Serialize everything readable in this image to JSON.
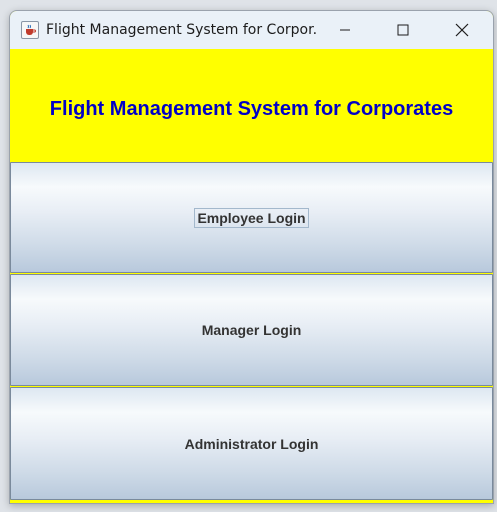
{
  "window": {
    "title": "Flight Management System for Corpor...",
    "app_icon": "java-cup-icon",
    "controls": {
      "minimize_icon": "minimize-icon",
      "maximize_icon": "maximize-icon",
      "close_icon": "close-icon"
    }
  },
  "header": {
    "title": "Flight Management System for Corporates",
    "background_color": "#ffff00",
    "title_color": "#0000c8"
  },
  "buttons": {
    "employee_login": "Employee Login",
    "manager_login": "Manager Login",
    "administrator_login": "Administrator Login",
    "focused": "employee_login"
  }
}
